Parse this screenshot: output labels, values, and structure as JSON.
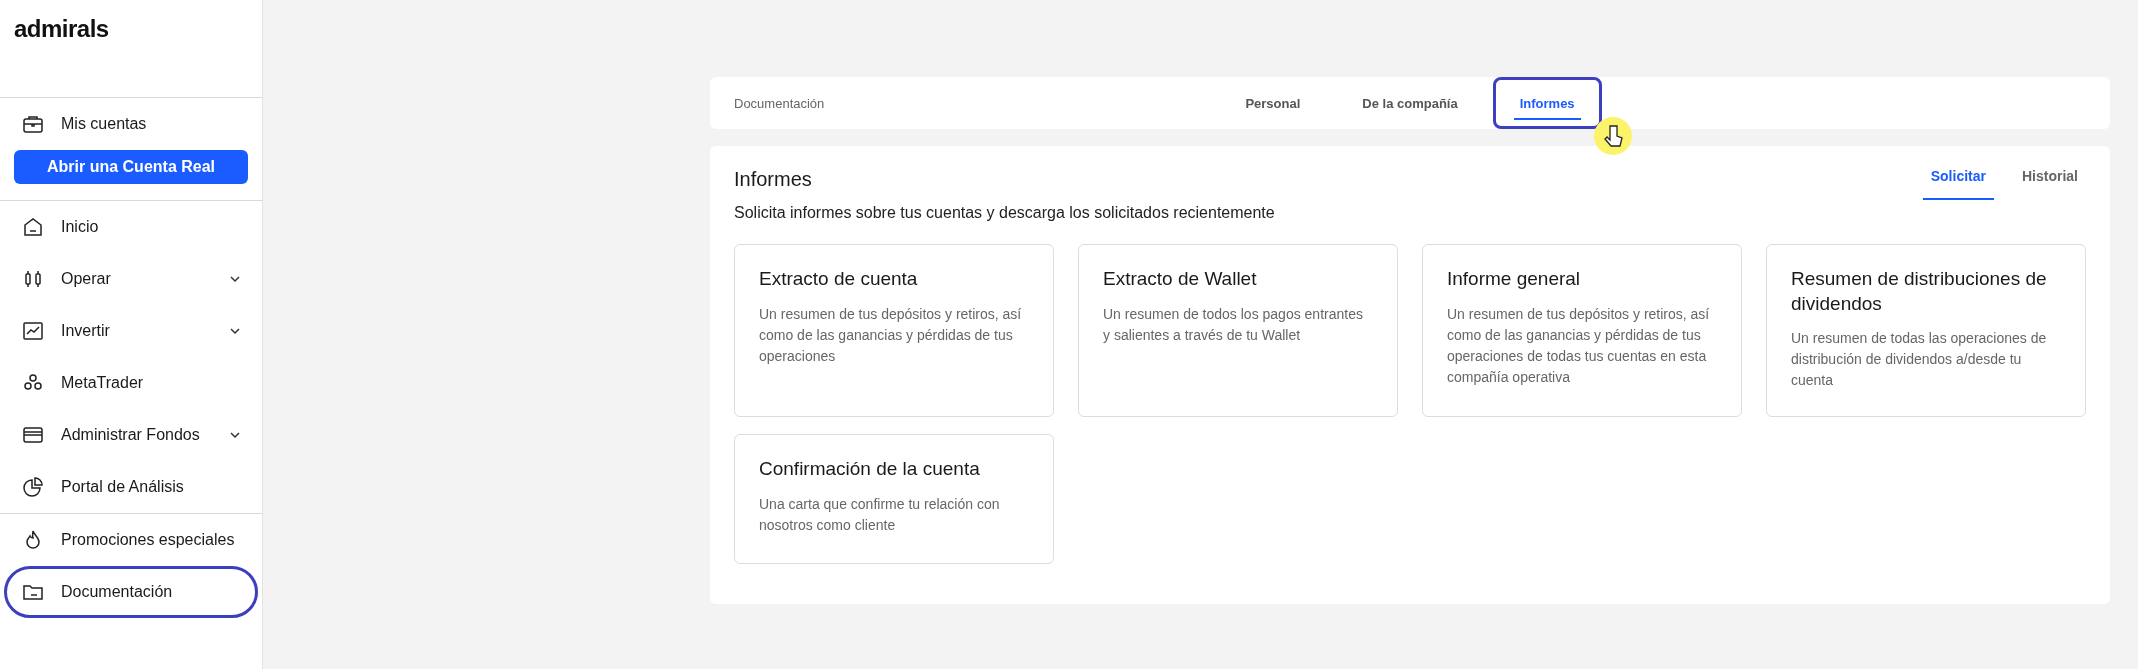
{
  "sidebar": {
    "logo": "admirals",
    "account_item": {
      "label": "Mis cuentas",
      "kind": "briefcase"
    },
    "cta_button": "Abrir una Cuenta Real",
    "items": [
      {
        "label": "Inicio",
        "kind": "home",
        "expandable": false,
        "highlighted": false
      },
      {
        "label": "Operar",
        "kind": "candles",
        "expandable": true,
        "highlighted": false
      },
      {
        "label": "Invertir",
        "kind": "chart",
        "expandable": true,
        "highlighted": false
      },
      {
        "label": "MetaTrader",
        "kind": "cluster",
        "expandable": false,
        "highlighted": false
      },
      {
        "label": "Administrar Fondos",
        "kind": "wallet",
        "expandable": true,
        "highlighted": false
      },
      {
        "label": "Portal de Análisis",
        "kind": "pie",
        "expandable": false,
        "highlighted": false
      }
    ],
    "bottom_items": [
      {
        "label": "Promociones especiales",
        "kind": "flame",
        "expandable": false,
        "highlighted": false
      },
      {
        "label": "Documentación",
        "kind": "folder",
        "expandable": false,
        "highlighted": true
      }
    ]
  },
  "top_bar": {
    "title": "Documentación",
    "tabs": [
      {
        "label": "Personal",
        "selected": false,
        "highlighted": false
      },
      {
        "label": "De la compañía",
        "selected": false,
        "highlighted": false
      },
      {
        "label": "Informes",
        "selected": true,
        "highlighted": true
      }
    ]
  },
  "panel": {
    "title": "Informes",
    "subtitle": "Solicita informes sobre tus cuentas y descarga los solicitados recientemente",
    "tabs": [
      {
        "label": "Solicitar",
        "selected": true
      },
      {
        "label": "Historial",
        "selected": false
      }
    ],
    "cards": [
      {
        "title": "Extracto de cuenta",
        "description": "Un resumen de tus depósitos y retiros, así como de las ganancias y pérdidas de tus operaciones"
      },
      {
        "title": "Extracto de Wallet",
        "description": "Un resumen de todos los pagos entrantes y salientes a través de tu Wallet"
      },
      {
        "title": "Informe general",
        "description": "Un resumen de tus depósitos y retiros, así como de las ganancias y pérdidas de tus operaciones de todas tus cuentas en esta compañía operativa"
      },
      {
        "title": "Resumen de distribuciones de dividendos",
        "description": "Un resumen de todas las operaciones de distribución de dividendos a/desde tu cuenta"
      },
      {
        "title": "Confirmación de la cuenta",
        "description": "Una carta que confirme tu relación con nosotros como cliente"
      }
    ]
  }
}
